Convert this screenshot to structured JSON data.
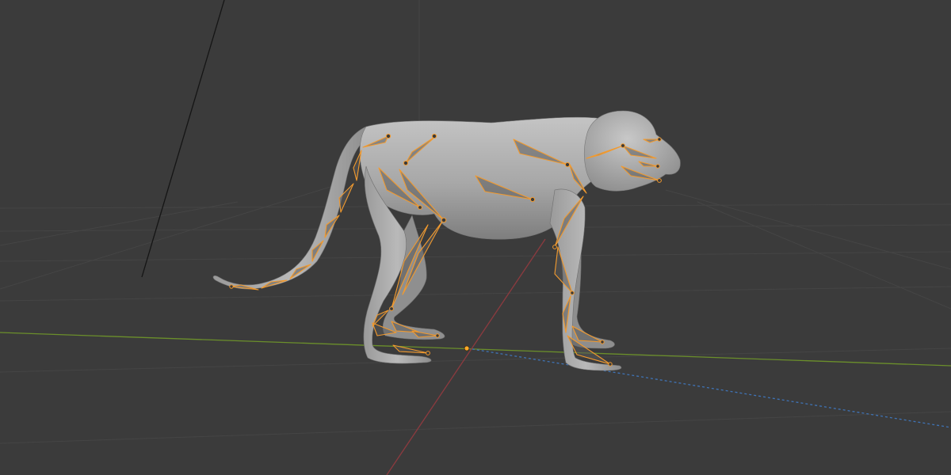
{
  "viewport": {
    "background": "#3b3b3b",
    "grid_color": "#454545",
    "x_axis_color": "#8c3a3f",
    "y_axis_color": "#6b8f2b",
    "z_axis_color": "#3f73b5",
    "mesh_color": "#a8a8a8",
    "mesh_shadow_color": "#6a6a6a",
    "armature_color": "#f29a2e",
    "armature_fill": "#5a5a5a",
    "origin_color": "#ffa928"
  },
  "scene": {
    "selected_object": "monkey-armature",
    "mode": "pose"
  }
}
